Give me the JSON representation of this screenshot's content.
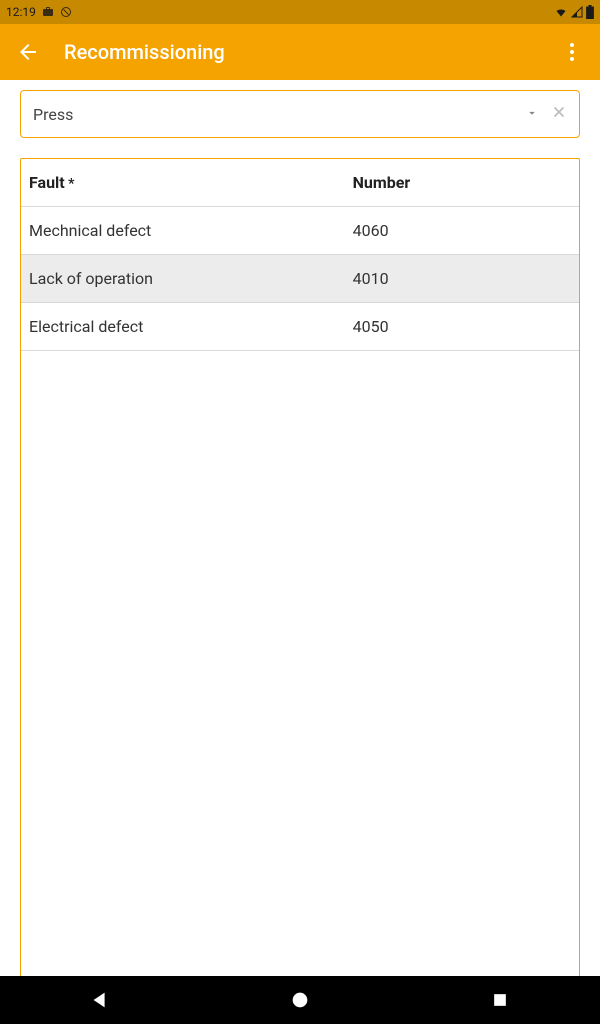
{
  "status": {
    "time": "12:19"
  },
  "header": {
    "title": "Recommissioning"
  },
  "dropdown": {
    "value": "Press"
  },
  "table": {
    "columns": {
      "fault": "Fault",
      "number": "Number"
    },
    "rows": [
      {
        "fault": "Mechnical defect",
        "number": "4060",
        "selected": false
      },
      {
        "fault": "Lack of operation",
        "number": "4010",
        "selected": true
      },
      {
        "fault": "Electrical defect",
        "number": "4050",
        "selected": false
      }
    ]
  }
}
